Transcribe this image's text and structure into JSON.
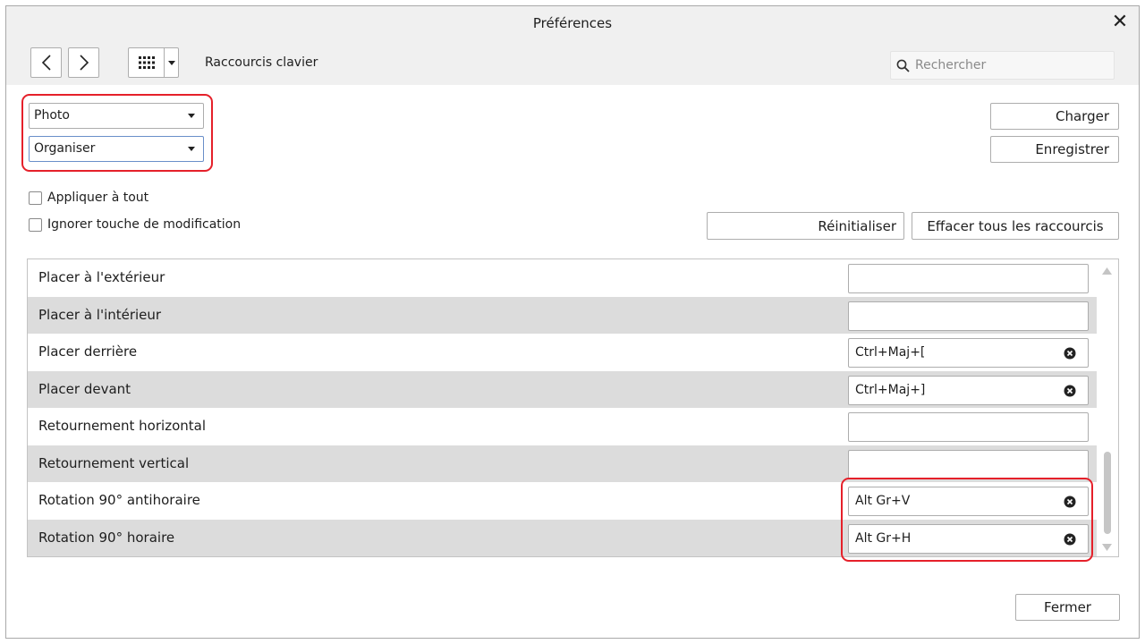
{
  "window": {
    "title": "Préférences"
  },
  "toolbar": {
    "back_label": "<",
    "forward_label": ">",
    "section_title": "Raccourcis clavier",
    "search_placeholder": "Rechercher"
  },
  "filters": {
    "app_select": "Photo",
    "category_select": "Organiser"
  },
  "actions": {
    "load": "Charger",
    "save": "Enregistrer",
    "reset": "Réinitialiser",
    "clear_all": "Effacer tous les raccourcis",
    "close": "Fermer"
  },
  "options": {
    "apply_all": "Appliquer à tout",
    "ignore_modifier": "Ignorer touche de modification"
  },
  "shortcuts": [
    {
      "name": "Placer à l'extérieur",
      "key": ""
    },
    {
      "name": "Placer à l'intérieur",
      "key": ""
    },
    {
      "name": "Placer derrière",
      "key": "Ctrl+Maj+["
    },
    {
      "name": "Placer devant",
      "key": "Ctrl+Maj+]"
    },
    {
      "name": "Retournement horizontal",
      "key": ""
    },
    {
      "name": "Retournement vertical",
      "key": ""
    },
    {
      "name": "Rotation 90° antihoraire",
      "key": "Alt Gr+V"
    },
    {
      "name": "Rotation 90° horaire",
      "key": "Alt Gr+H"
    }
  ],
  "colors": {
    "highlight": "#e5202a",
    "row_alt": "#dcdcdc",
    "chrome": "#f0f0f0"
  },
  "icons": {
    "search": "search-icon",
    "grid": "grid-icon",
    "clear": "clear-circle-icon",
    "close": "close-icon"
  }
}
